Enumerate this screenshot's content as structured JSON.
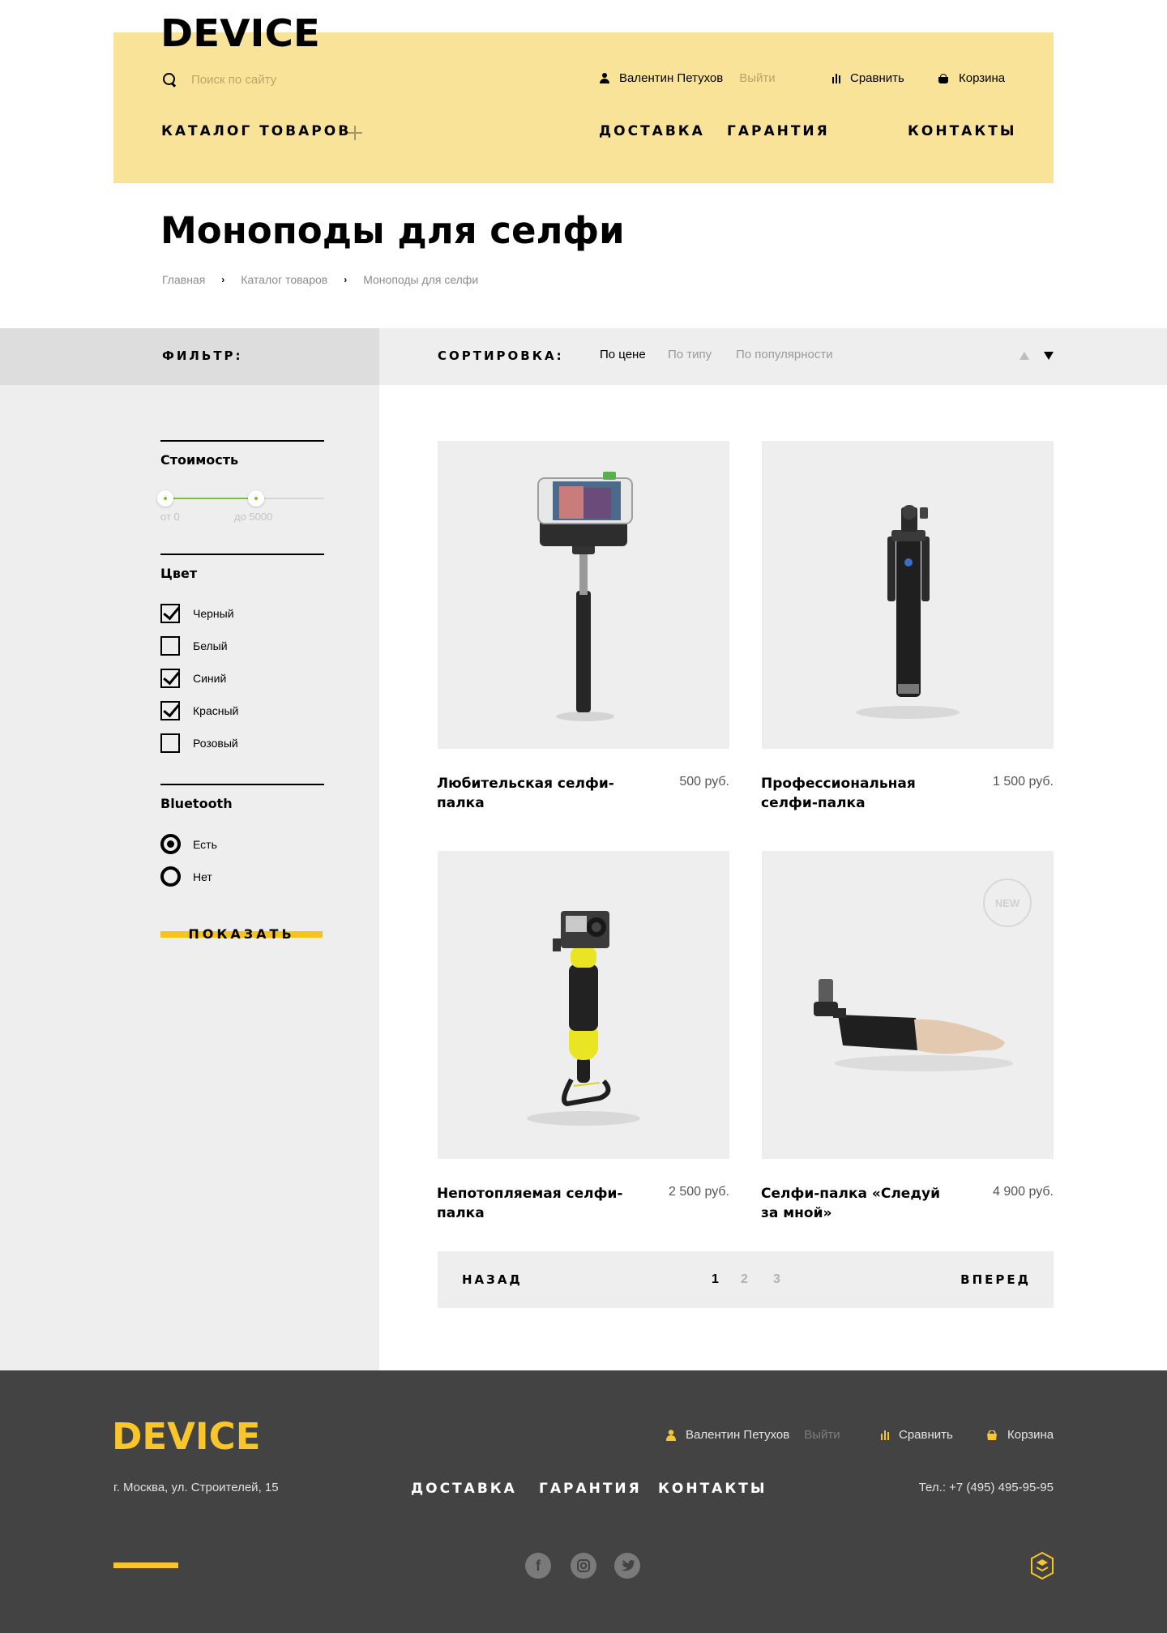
{
  "header": {
    "logo": "DEVICE",
    "search_placeholder": "Поиск по сайту",
    "user_name": "Валентин Петухов",
    "logout": "Выйти",
    "compare": "Сравнить",
    "cart": "Корзина",
    "catalog": "КАТАЛОГ ТОВАРОВ",
    "nav": [
      "ДОСТАВКА",
      "ГАРАНТИЯ",
      "КОНТАКТЫ"
    ]
  },
  "page": {
    "title": "Моноподы для селфи",
    "breadcrumb": [
      "Главная",
      "Каталог товаров",
      "Моноподы для селфи"
    ]
  },
  "filter_bar": {
    "filter_label": "ФИЛЬТР:",
    "sort_label": "СОРТИРОВКА:",
    "sort_options": [
      "По цене",
      "По типу",
      "По популярности"
    ],
    "active_sort": "По цене",
    "sort_direction": "descending"
  },
  "filters": {
    "price": {
      "title": "Стоимость",
      "from_label": "от 0",
      "to_label": "до 5000",
      "range_start_fraction": 0.0,
      "range_end_fraction": 0.57
    },
    "color": {
      "title": "Цвет",
      "options": [
        {
          "label": "Черный",
          "checked": true
        },
        {
          "label": "Белый",
          "checked": false
        },
        {
          "label": "Синий",
          "checked": true
        },
        {
          "label": "Красный",
          "checked": true
        },
        {
          "label": "Розовый",
          "checked": false
        }
      ]
    },
    "bluetooth": {
      "title": "Bluetooth",
      "options": [
        {
          "label": "Есть",
          "checked": true
        },
        {
          "label": "Нет",
          "checked": false
        }
      ]
    },
    "show_button": "ПОКАЗАТЬ"
  },
  "products": [
    {
      "name": "Любительская селфи-палка",
      "price": "500 руб.",
      "image": "selfie-stick-phone"
    },
    {
      "name": "Профессиональная селфи-палка",
      "price": "1 500 руб.",
      "image": "selfie-stick-bluetooth"
    },
    {
      "name": "Непотопляемая селфи-палка",
      "price": "2 500 руб.",
      "image": "floating-grip-action-camera"
    },
    {
      "name": "Селфи-палка «Следуй за мной»",
      "price": "4 900 руб.",
      "image": "arm-selfie-stick",
      "badge": "NEW"
    }
  ],
  "pagination": {
    "back": "НАЗАД",
    "forward": "ВПЕРЕД",
    "pages": [
      "1",
      "2",
      "3"
    ],
    "current": "1"
  },
  "footer": {
    "logo": "DEVICE",
    "user_name": "Валентин Петухов",
    "logout": "Выйти",
    "compare": "Сравнить",
    "cart": "Корзина",
    "address": "г. Москва, ул. Строителей, 15",
    "nav": [
      "ДОСТАВКА",
      "ГАРАНТИЯ",
      "КОНТАКТЫ"
    ],
    "phone": "Тел.: +7 (495) 495-95-95",
    "social": [
      "facebook-icon",
      "instagram-icon",
      "twitter-icon"
    ]
  },
  "colors": {
    "header_bg": "#f8e398",
    "accent_yellow": "#f7c31b",
    "range_green": "#7bc043",
    "footer_bg": "#434343"
  }
}
